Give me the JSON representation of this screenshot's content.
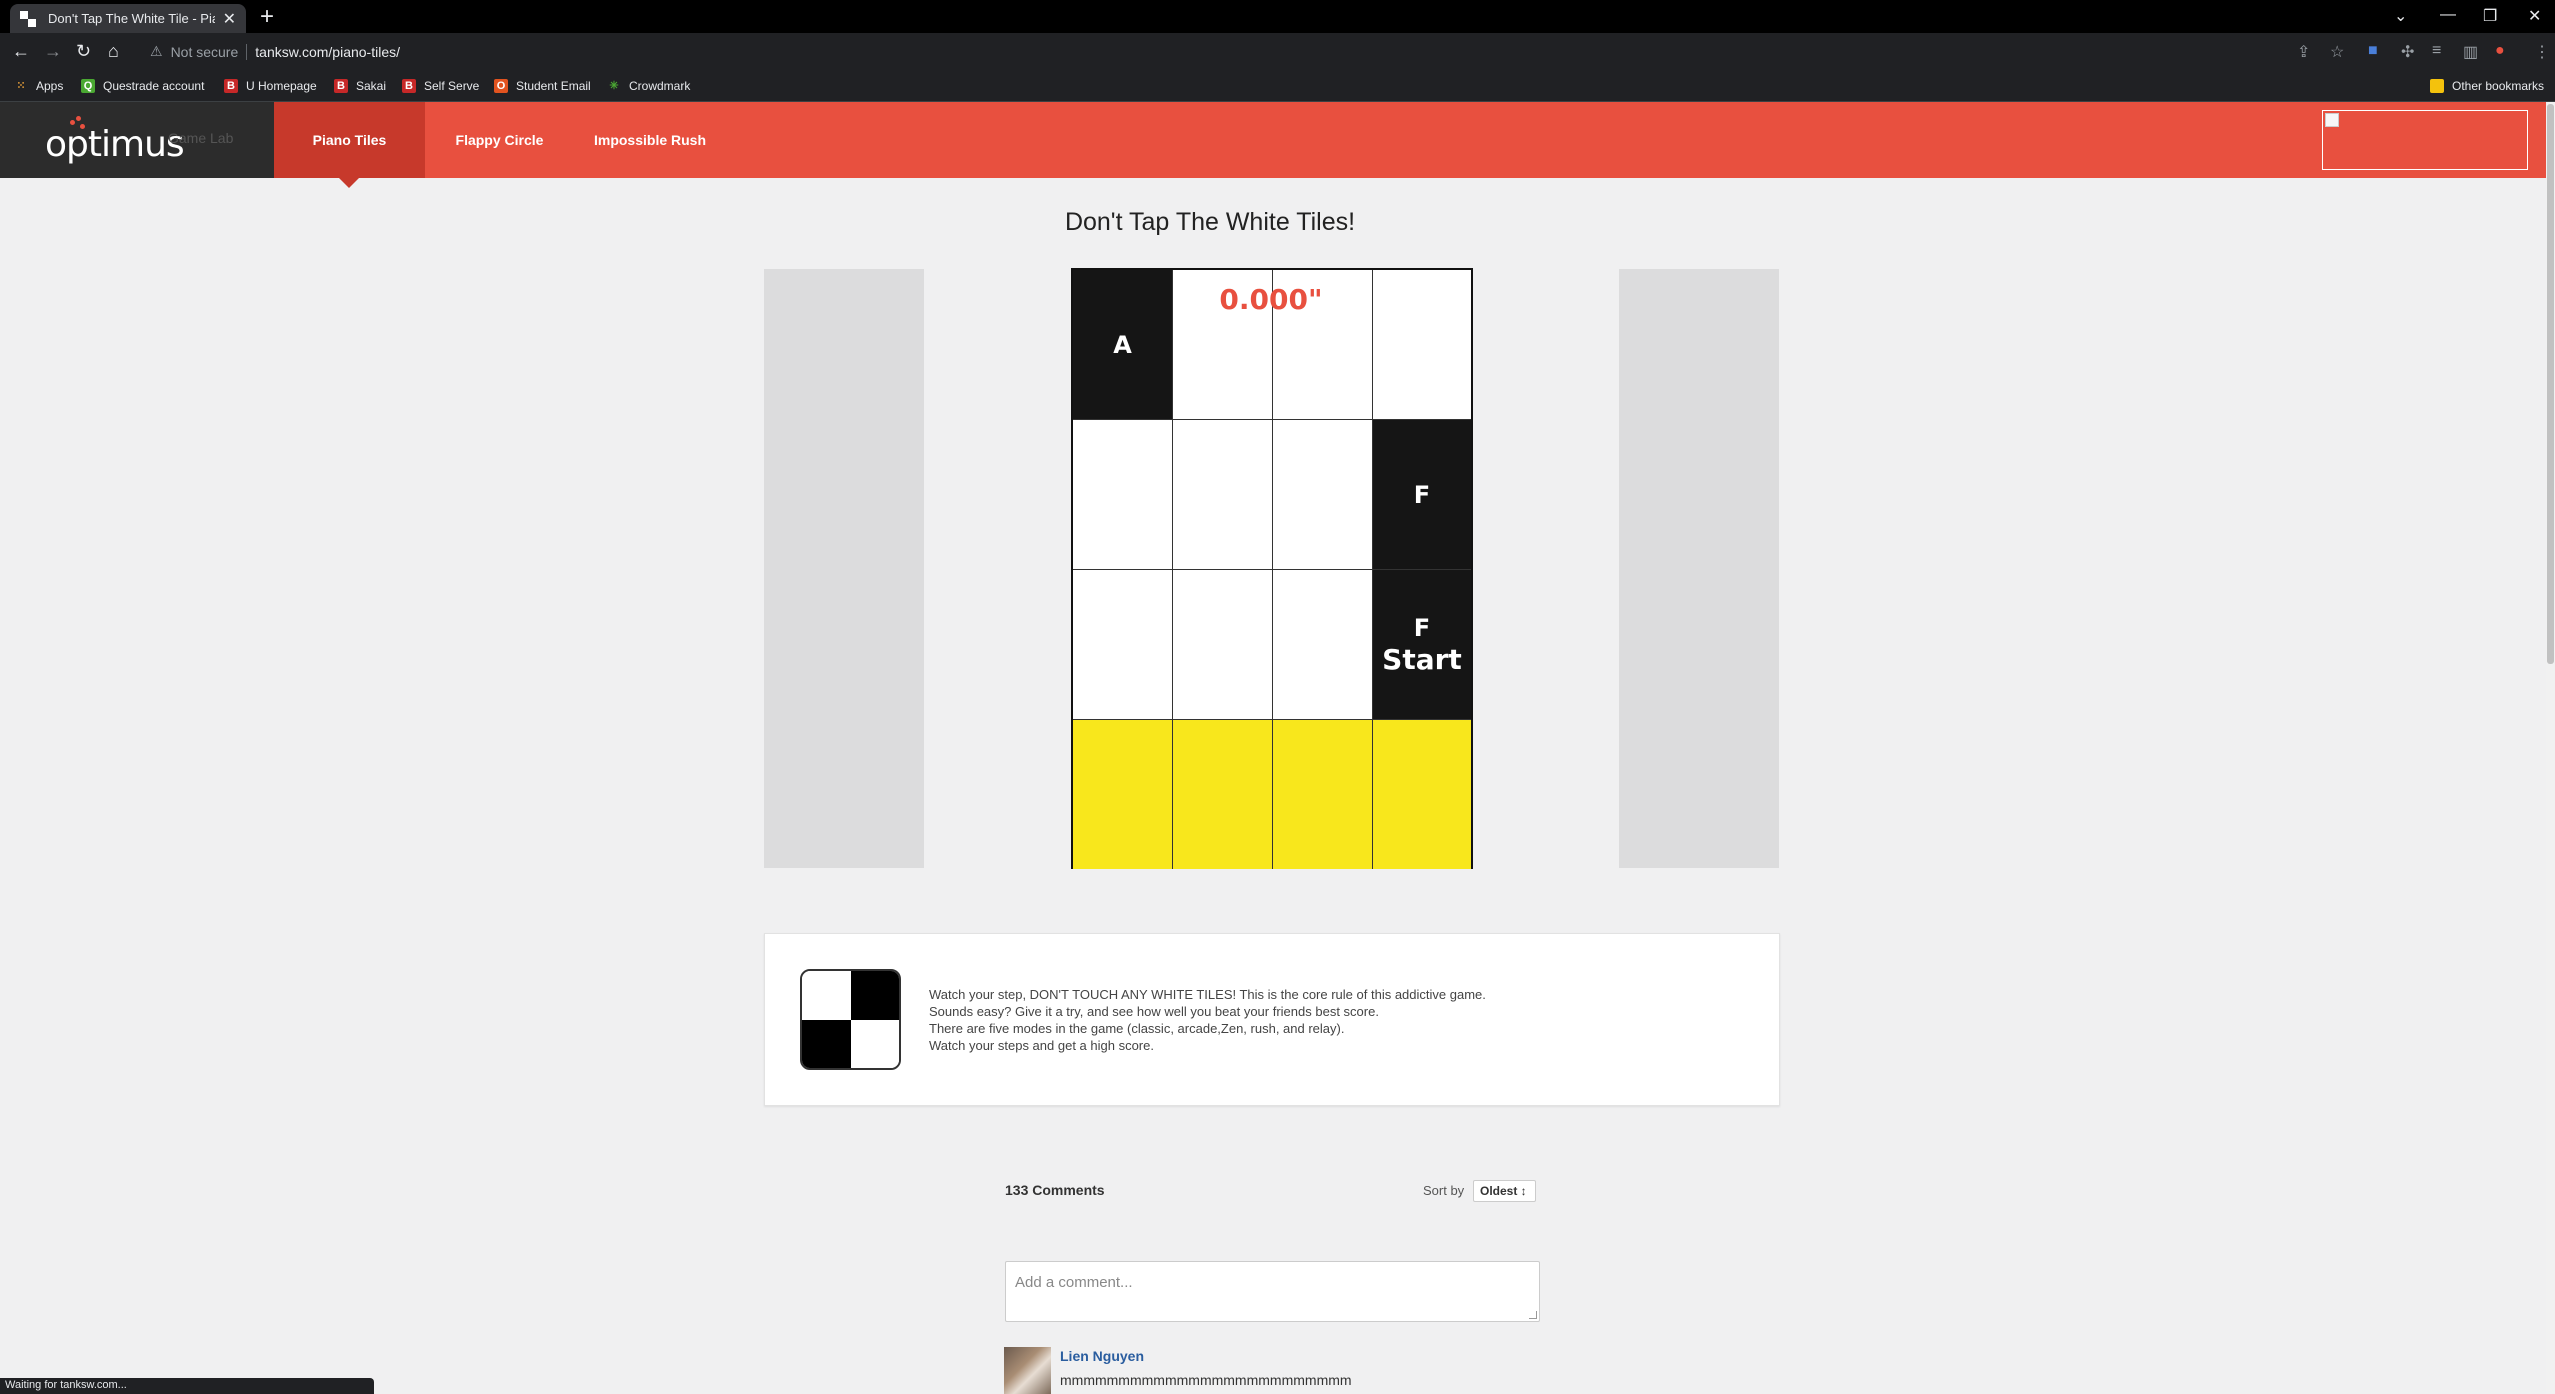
{
  "browser": {
    "tab_title": "Don't Tap The White Tile - Piano",
    "new_tab": "+",
    "security_label": "Not secure",
    "url": "tanksw.com/piano-tiles/",
    "bookmarks": [
      {
        "label": "Apps",
        "icon": "apps-grid-icon"
      },
      {
        "label": "Questrade account",
        "icon": "questrade-icon"
      },
      {
        "label": "U Homepage",
        "icon": "b-icon"
      },
      {
        "label": "Sakai",
        "icon": "b-icon"
      },
      {
        "label": "Self Serve",
        "icon": "b-icon"
      },
      {
        "label": "Student Email",
        "icon": "office-icon"
      },
      {
        "label": "Crowdmark",
        "icon": "crowdmark-icon"
      }
    ],
    "other_bookmarks": "Other bookmarks",
    "status_text": "Waiting for tanksw.com..."
  },
  "site": {
    "logo": "optimus",
    "logo_sub": "Game Lab",
    "nav": [
      {
        "label": "Piano Tiles",
        "active": true
      },
      {
        "label": "Flappy Circle",
        "active": false
      },
      {
        "label": "Impossible Rush",
        "active": false
      }
    ],
    "accent_color": "#e8503f"
  },
  "game": {
    "title": "Don't Tap The White Tiles!",
    "timer": "0.000\"",
    "rows": [
      [
        {
          "type": "black",
          "key": "A"
        },
        {
          "type": "white"
        },
        {
          "type": "white"
        },
        {
          "type": "white"
        }
      ],
      [
        {
          "type": "white"
        },
        {
          "type": "white"
        },
        {
          "type": "white"
        },
        {
          "type": "black",
          "key": "F"
        }
      ],
      [
        {
          "type": "white"
        },
        {
          "type": "white"
        },
        {
          "type": "white"
        },
        {
          "type": "black",
          "key": "F",
          "label": "Start"
        }
      ],
      [
        {
          "type": "yellow"
        },
        {
          "type": "yellow"
        },
        {
          "type": "yellow"
        },
        {
          "type": "yellow"
        }
      ]
    ]
  },
  "description": {
    "lines": [
      "Watch your step, DON'T TOUCH ANY WHITE TILES! This is the core rule of this addictive game.",
      "Sounds easy? Give it a try, and see how well you beat your friends best score.",
      "There are five modes in the game (classic, arcade,Zen, rush, and relay).",
      "Watch your steps and get a high score."
    ]
  },
  "comments": {
    "count_label": "133 Comments",
    "sort_label": "Sort by",
    "sort_value": "Oldest ↕",
    "input_placeholder": "Add a comment...",
    "items": [
      {
        "author": "Lien Nguyen",
        "text": "mmmmmmmmmmmmmmmmmmmmmmmmm"
      }
    ]
  }
}
